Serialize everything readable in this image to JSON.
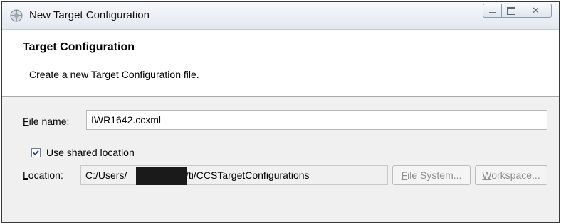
{
  "window": {
    "title": "New Target Configuration",
    "controls": {
      "minimize": "—",
      "maximize": "□",
      "close": "✕"
    }
  },
  "header": {
    "title": "Target Configuration",
    "description": "Create a new Target Configuration file."
  },
  "form": {
    "file_name": {
      "label_mnemonic": "F",
      "label_rest": "ile name:",
      "value": "IWR1642.ccxml"
    },
    "use_shared": {
      "label_pre": "Use ",
      "label_mnemonic": "s",
      "label_rest": "hared location",
      "checked": true
    },
    "location": {
      "label_mnemonic": "L",
      "label_rest": "ocation:",
      "value_prefix": "C:/Users/",
      "value_suffix": "/ti/CCSTargetConfigurations"
    },
    "buttons": {
      "file_system": {
        "mnemonic": "F",
        "rest": "ile System..."
      },
      "workspace": {
        "mnemonic": "W",
        "rest": "orkspace..."
      }
    }
  }
}
